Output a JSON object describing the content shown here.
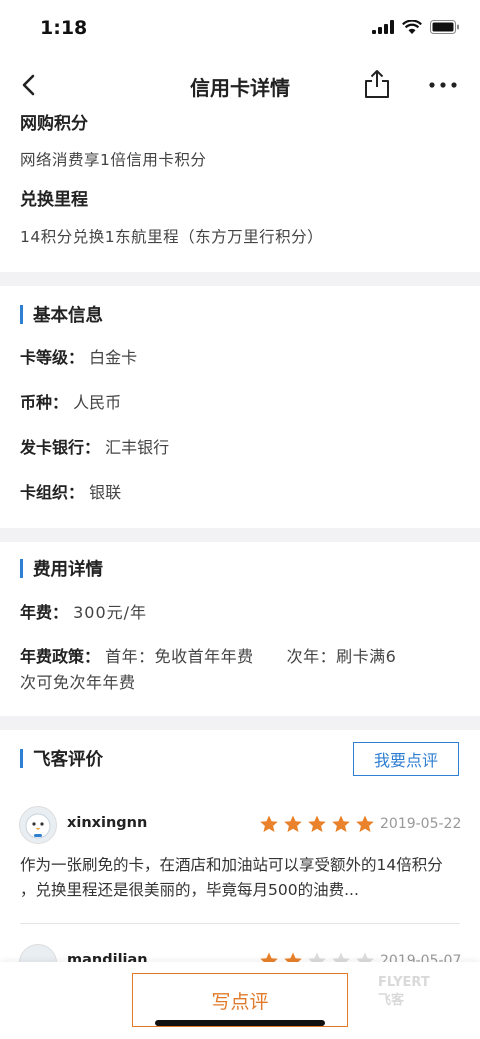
{
  "status_bar": {
    "time": "1:18"
  },
  "nav": {
    "title": "信用卡详情",
    "back_icon": "back-arrow-icon",
    "share_icon": "share-icon",
    "more_icon": "more-icon"
  },
  "top": {
    "online_points_title": "网购积分",
    "online_points_desc": "网络消费享1倍信用卡积分",
    "redeem_title": "兑换里程",
    "redeem_desc": "14积分兑换1东航里程（东方万里行积分）"
  },
  "basic": {
    "heading": "基本信息",
    "rows": [
      {
        "label": "卡等级：",
        "value": "白金卡"
      },
      {
        "label": "币种：",
        "value": "人民币"
      },
      {
        "label": "发卡银行：",
        "value": "汇丰银行"
      },
      {
        "label": "卡组织：",
        "value": "银联"
      }
    ]
  },
  "fees": {
    "heading": "费用详情",
    "annual_label": "年费：",
    "annual_value": "300元/年",
    "policy_label": "年费政策：",
    "policy_line1": "首年：免收首年年费　　次年：刷卡满6",
    "policy_line2": "次可免次年年费"
  },
  "reviews": {
    "heading": "飞客评价",
    "write_review_label": "我要点评",
    "items": [
      {
        "user": "xinxingnn",
        "rating": 5,
        "date": "2019-05-22",
        "text_line1": "作为一张刷免的卡，在酒店和加油站可以享受额外的14倍积分",
        "text_line2": "，兑换里程还是很美丽的，毕竟每月500的油费..."
      },
      {
        "user": "mandilian",
        "rating": 2,
        "date": "2019-05-07"
      }
    ]
  },
  "bottom": {
    "write_button": "写点评",
    "watermark_line1": "FLYERT",
    "watermark_line2": "飞客"
  },
  "colors": {
    "accent_blue": "#2f7fd2",
    "accent_orange": "#e07a2a",
    "star": "#e9822b",
    "star_empty": "#dcdcdc"
  }
}
